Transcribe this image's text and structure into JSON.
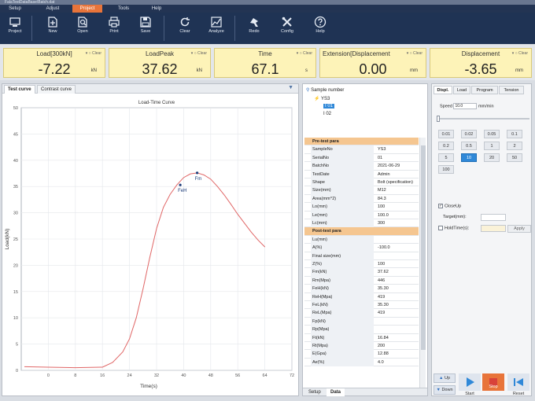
{
  "window": {
    "title": "FalaTestDataBase\\Batch.dat"
  },
  "menu": {
    "items": [
      "Setup",
      "Adjust",
      "Project",
      "Tools",
      "Help"
    ],
    "active": "Project"
  },
  "toolbar": {
    "items": [
      {
        "label": "Project",
        "icon": "project-icon"
      },
      {
        "label": "New",
        "icon": "new-file-icon"
      },
      {
        "label": "Open",
        "icon": "open-search-icon"
      },
      {
        "label": "Print",
        "icon": "printer-icon"
      },
      {
        "label": "Save",
        "icon": "save-icon"
      },
      {
        "label": "Clear",
        "icon": "refresh-icon"
      },
      {
        "label": "Analyze",
        "icon": "analyze-icon"
      },
      {
        "label": "Redo",
        "icon": "redo-icon"
      },
      {
        "label": "Config",
        "icon": "tools-icon"
      },
      {
        "label": "Help",
        "icon": "help-icon"
      }
    ]
  },
  "readouts": [
    {
      "title": "Load[300kN]",
      "value": "-7.22",
      "unit": "kN",
      "clear": "Clear"
    },
    {
      "title": "LoadPeak",
      "value": "37.62",
      "unit": "kN",
      "clear": "Clear"
    },
    {
      "title": "Time",
      "value": "67.1",
      "unit": "s",
      "clear": "Clear"
    },
    {
      "title": "Extension[Displacement",
      "value": "0.00",
      "unit": "mm",
      "clear": "Clear"
    },
    {
      "title": "Displacement",
      "value": "-3.65",
      "unit": "mm",
      "clear": "Clear"
    }
  ],
  "chart_tabs": [
    "Test curve",
    "Contrast curve"
  ],
  "chart_data": {
    "type": "line",
    "title": "Load-Time Curve",
    "xlabel": "Time(s)",
    "ylabel": "Load(kN)",
    "xlim": [
      -8,
      72
    ],
    "ylim": [
      0,
      50
    ],
    "xticks": [
      "0",
      "8",
      "16",
      "24",
      "32",
      "40",
      "48",
      "56",
      "64",
      "72"
    ],
    "yticks": [
      "0",
      "5",
      "10",
      "15",
      "20",
      "25",
      "30",
      "35",
      "40",
      "45",
      "50"
    ],
    "grid": true,
    "series": [
      {
        "color": "#e06666",
        "x": [
          -7,
          0,
          8,
          16,
          19,
          22,
          24,
          26,
          28,
          30,
          32,
          34,
          36,
          38,
          40,
          42,
          44,
          46,
          48,
          50,
          52,
          54,
          56,
          58,
          60,
          62,
          64
        ],
        "y": [
          0.7,
          0.6,
          0.5,
          0.6,
          1.5,
          3.5,
          6.0,
          10.0,
          15.5,
          21.5,
          27.0,
          31.0,
          33.5,
          35.3,
          36.7,
          37.4,
          37.6,
          37.2,
          36.4,
          35.0,
          33.4,
          31.6,
          29.7,
          28.0,
          26.3,
          24.8,
          23.5
        ]
      }
    ],
    "annotations": [
      {
        "label": "FeH",
        "x": 39,
        "y": 35.3
      },
      {
        "label": "Fm",
        "x": 44,
        "y": 37.6
      }
    ]
  },
  "sample_tree": {
    "header": "Sample number",
    "batch": "YS3",
    "items": [
      "01",
      "02"
    ]
  },
  "params": {
    "pretest_header": "Pre-test para",
    "pretest": [
      {
        "k": "SampleNo",
        "v": "YS3"
      },
      {
        "k": "SerialNo",
        "v": "01"
      },
      {
        "k": "BatchNo",
        "v": "2021-06-29"
      },
      {
        "k": "TestDate",
        "v": "Admin"
      },
      {
        "k": "Shape",
        "v": "Bolt (specification)"
      },
      {
        "k": "Size(mm)",
        "v": "M12"
      },
      {
        "k": "Area(mm^2)",
        "v": "84.3"
      },
      {
        "k": "Lo(mm)",
        "v": "100"
      },
      {
        "k": "Le(mm)",
        "v": "100.0"
      },
      {
        "k": "Lc(mm)",
        "v": "300"
      }
    ],
    "posttest_header": "Post-test para",
    "posttest": [
      {
        "k": "Lu(mm)",
        "v": ""
      },
      {
        "k": "A(%)",
        "v": "-100.0"
      },
      {
        "k": "Final size(mm)",
        "v": ""
      },
      {
        "k": "Z(%)",
        "v": "100"
      },
      {
        "k": "Fm(kN)",
        "v": "37.62"
      },
      {
        "k": "Rm(Mpa)",
        "v": "446"
      },
      {
        "k": "FeH(kN)",
        "v": "35.30"
      },
      {
        "k": "ReH(Mpa)",
        "v": "419"
      },
      {
        "k": "FeL(kN)",
        "v": "35.30"
      },
      {
        "k": "ReL(Mpa)",
        "v": "419"
      },
      {
        "k": "Fp(kN)",
        "v": ""
      },
      {
        "k": "Rp(Mpa)",
        "v": ""
      },
      {
        "k": "Ft(kN)",
        "v": "16.84"
      },
      {
        "k": "Rt(Mpa)",
        "v": "200"
      },
      {
        "k": "E(Gpa)",
        "v": "12.88"
      },
      {
        "k": "Ae(%)",
        "v": "4.0"
      }
    ]
  },
  "mid_tabs": [
    "Setup",
    "Data"
  ],
  "right": {
    "tabs": [
      "Displ.",
      "Load",
      "Program",
      "Tension"
    ],
    "speed_label": "Speed",
    "speed_value": "10.0",
    "speed_unit": "mm/min",
    "speed_buttons": [
      "0.01",
      "0.02",
      "0.05",
      "0.1",
      "0.2",
      "0.5",
      "1",
      "2",
      "5",
      "10",
      "20",
      "50",
      "100"
    ],
    "speed_active": "10",
    "closeup_label": "CloseUp",
    "target_label": "Target(mm):",
    "holdtime_label": "HoldTime(s):",
    "apply_label": "Apply",
    "controls": [
      {
        "label": "Up",
        "icon": "up-arrow-icon"
      },
      {
        "label": "Down",
        "icon": "down-arrow-icon"
      },
      {
        "label": "Start",
        "icon": "play-icon"
      },
      {
        "label": "Stop",
        "icon": "stop-icon"
      },
      {
        "label": "Reset",
        "icon": "reset-icon"
      }
    ]
  }
}
